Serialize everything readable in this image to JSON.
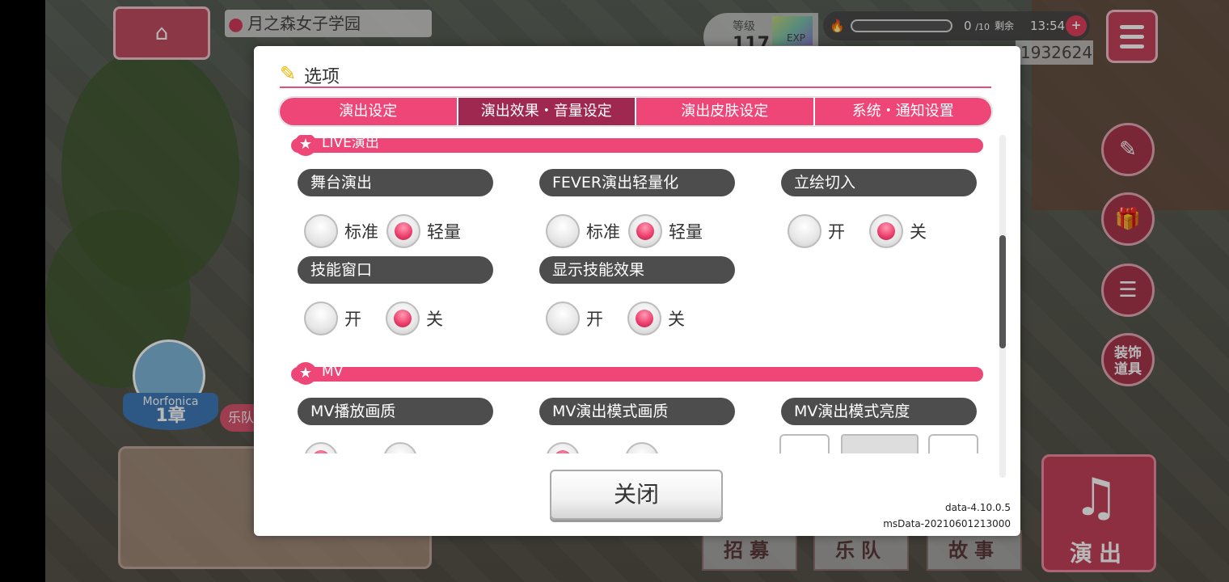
{
  "background": {
    "location_school": "月之森女子学园",
    "level_label": "等级",
    "level_value": "117",
    "exp_label": "EXP",
    "stamina_value": "0",
    "stamina_max": "/10",
    "remaining_label": "剩余",
    "remaining_time": "13:54",
    "coins": "1932624",
    "side_deco_label": "装饰\n道具",
    "chapter_band": "Morfonica",
    "chapter_num": "1章",
    "tag_text": "乐队",
    "bottom_buttons": [
      "招募",
      "乐队",
      "故事"
    ],
    "live_button": "演出"
  },
  "modal": {
    "title": "选项",
    "tabs": [
      "演出设定",
      "演出效果・音量设定",
      "演出皮肤设定",
      "系统・通知设置"
    ],
    "active_tab": 1,
    "sections": [
      {
        "title": "LIVE演出",
        "options": [
          {
            "label": "舞台演出",
            "choices": [
              "标准",
              "轻量"
            ],
            "selected": 1
          },
          {
            "label": "FEVER演出轻量化",
            "choices": [
              "标准",
              "轻量"
            ],
            "selected": 1
          },
          {
            "label": "立绘切入",
            "choices": [
              "开",
              "关"
            ],
            "selected": 1
          },
          {
            "label": "技能窗口",
            "choices": [
              "开",
              "关"
            ],
            "selected": 1
          },
          {
            "label": "显示技能效果",
            "choices": [
              "开",
              "关"
            ],
            "selected": 1
          }
        ]
      },
      {
        "title": "MV",
        "options": [
          {
            "label": "MV播放画质"
          },
          {
            "label": "MV演出模式画质"
          },
          {
            "label": "MV演出模式亮度"
          }
        ]
      }
    ],
    "close_label": "关闭",
    "version_data": "data-4.10.0.5",
    "version_msdata": "msData-20210601213000"
  },
  "colors": {
    "accent_pink": "#ee4677",
    "active_tab": "#9e2850",
    "label_bg": "#4d4d4d"
  }
}
